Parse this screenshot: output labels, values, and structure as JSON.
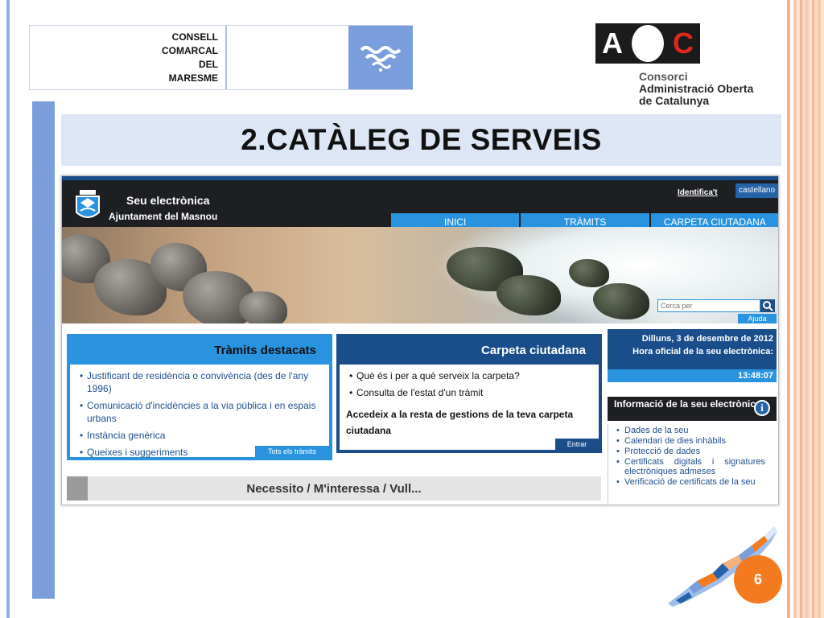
{
  "consell": {
    "line1": "CONSELL",
    "line2": "COMARCAL",
    "line3": "DEL",
    "line4": "MARESME"
  },
  "aoc": {
    "a": "A",
    "c": "C",
    "line1": "Consorci",
    "line2": "Administració Oberta",
    "line3": "de Catalunya"
  },
  "slide": {
    "title": "2.CATÀLEG DE SERVEIS",
    "page_number": "6"
  },
  "site": {
    "title": "Seu electrònica",
    "subtitle": "Ajuntament del Masnou",
    "identificat": "Identifica't",
    "language": "castellano",
    "nav": [
      "INICI",
      "TRÀMITS",
      "CARPETA CIUTADANA"
    ],
    "search_placeholder": "Cerca per",
    "help": "Ajuda"
  },
  "tramits": {
    "heading": "Tràmits destacats",
    "items": [
      "Justificant de residència o convivència (des de l'any 1996)",
      "Comunicació d'incidències a la via pública i en espais urbans",
      "Instància genèrica",
      "Queixes i suggeriments"
    ],
    "footer": "Tots els tràmits"
  },
  "carpeta": {
    "heading": "Carpeta ciutadana",
    "items": [
      "Què és i per a què serveix la carpeta?",
      "Consulta de l'estat d'un tràmit"
    ],
    "text": "Accedeix a la resta de gestions de la teva carpeta ciutadana",
    "footer": "Entrar"
  },
  "clock": {
    "date": "Dilluns, 3 de desembre de 2012",
    "label": "Hora oficial de la seu electrònica:",
    "time": "13:48:07"
  },
  "info": {
    "heading": "Informació de la seu electrònica",
    "items": [
      "Dades de la seu",
      "Calendari de dies inhàbils",
      "Protecció de dades",
      "Certificats digitals i signatures electròniques admeses",
      "Verificació de certificats de la seu"
    ]
  },
  "necessito": "Necessito / M'interessa / Vull...",
  "colors": {
    "slide_blue": "#7a9edc",
    "site_blue": "#2a93df",
    "site_navy": "#1a4e8a",
    "accent_orange": "#f47a20",
    "aoc_red": "#e1261c"
  }
}
